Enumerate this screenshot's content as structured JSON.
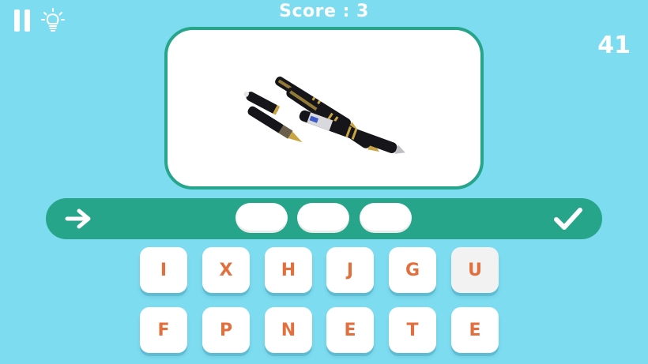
{
  "header": {
    "score_text": "Score : 3",
    "timer": "41",
    "pause_icon": "pause-icon",
    "hint_icon": "lightbulb-icon"
  },
  "image": {
    "subject": "pens",
    "icon": "pens-picture"
  },
  "answer": {
    "slots": [
      "",
      "",
      ""
    ],
    "back_icon": "arrow-right-icon",
    "submit_icon": "checkmark-icon"
  },
  "keyboard": {
    "row1": [
      "I",
      "X",
      "H",
      "J",
      "G",
      "U"
    ],
    "row2": [
      "F",
      "P",
      "N",
      "E",
      "T",
      "E"
    ]
  },
  "colors": {
    "background": "#7ddcf0",
    "accent": "#27a58a",
    "letter": "#e2703f",
    "white": "#ffffff"
  }
}
